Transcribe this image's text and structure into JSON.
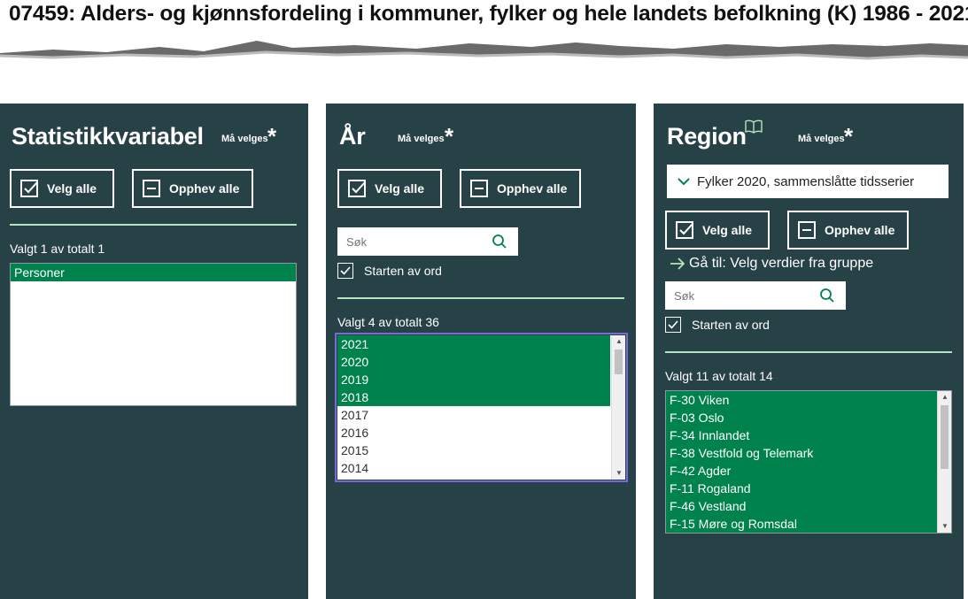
{
  "page": {
    "title": "07459: Alders- og kjønnsfordeling i kommuner, fylker og hele landets befolkning (K) 1986 - 2021"
  },
  "colors": {
    "panel_bg": "#274247",
    "selected_bg": "#00824d",
    "divider": "#b7e4b9",
    "focus_outline": "#7b68d9"
  },
  "common": {
    "required_label": "Må velges",
    "required_star": "*",
    "select_all": "Velg alle",
    "deselect_all": "Opphev alle",
    "search_placeholder": "Søk",
    "word_start_label": "Starten av ord"
  },
  "statistikk": {
    "title": "Statistikkvariabel",
    "count_text": "Valgt 1 av totalt 1",
    "items": [
      {
        "label": "Personer",
        "selected": true
      }
    ]
  },
  "aar": {
    "title": "År",
    "count_text": "Valgt 4 av totalt 36",
    "items": [
      {
        "label": "2021",
        "selected": true
      },
      {
        "label": "2020",
        "selected": true
      },
      {
        "label": "2019",
        "selected": true
      },
      {
        "label": "2018",
        "selected": true
      },
      {
        "label": "2017",
        "selected": false
      },
      {
        "label": "2016",
        "selected": false
      },
      {
        "label": "2015",
        "selected": false
      },
      {
        "label": "2014",
        "selected": false
      }
    ]
  },
  "region": {
    "title": "Region",
    "info_icon": "book-icon",
    "dropdown_value": "Fylker 2020, sammenslåtte tidsserier",
    "goto_text": "Gå til: Velg verdier fra gruppe",
    "count_text": "Valgt 11 av totalt 14",
    "items": [
      {
        "label": "F-30 Viken",
        "selected": true
      },
      {
        "label": "F-03 Oslo",
        "selected": true
      },
      {
        "label": "F-34 Innlandet",
        "selected": true
      },
      {
        "label": "F-38 Vestfold og Telemark",
        "selected": true
      },
      {
        "label": "F-42 Agder",
        "selected": true
      },
      {
        "label": "F-11 Rogaland",
        "selected": true
      },
      {
        "label": "F-46 Vestland",
        "selected": true
      },
      {
        "label": "F-15 Møre og Romsdal",
        "selected": true
      }
    ]
  }
}
